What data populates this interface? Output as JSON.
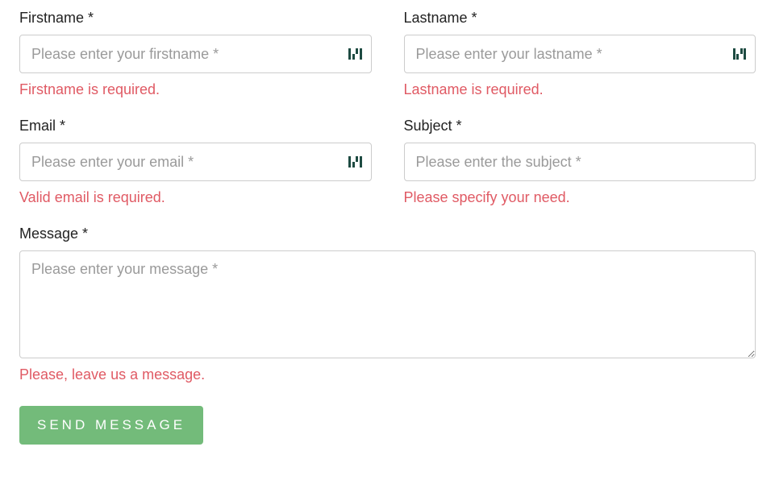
{
  "form": {
    "firstname": {
      "label": "Firstname *",
      "placeholder": "Please enter your firstname *",
      "error": "Firstname is required."
    },
    "lastname": {
      "label": "Lastname *",
      "placeholder": "Please enter your lastname *",
      "error": "Lastname is required."
    },
    "email": {
      "label": "Email *",
      "placeholder": "Please enter your email *",
      "error": "Valid email is required."
    },
    "subject": {
      "label": "Subject *",
      "placeholder": "Please enter the subject *",
      "error": "Please specify your need."
    },
    "message": {
      "label": "Message *",
      "placeholder": "Please enter your message *",
      "error": "Please, leave us a message."
    },
    "submit_label": "SEND MESSAGE"
  }
}
